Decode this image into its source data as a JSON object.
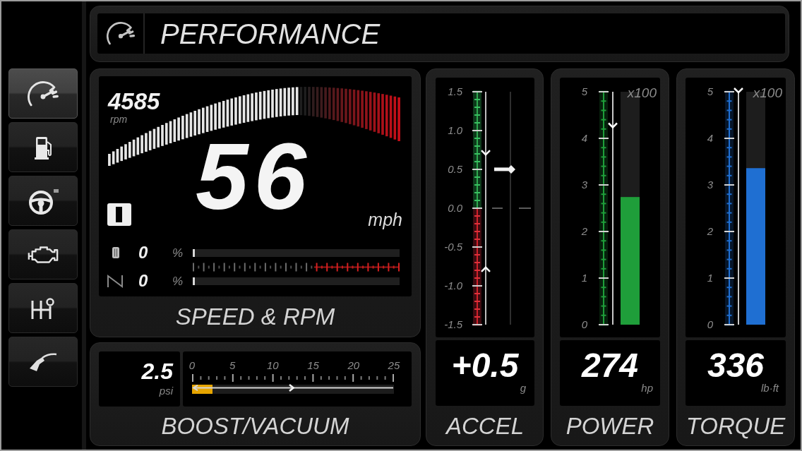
{
  "sidebar": {
    "items": [
      {
        "selected": true
      },
      {
        "selected": false
      },
      {
        "selected": false
      },
      {
        "selected": false
      },
      {
        "selected": false
      },
      {
        "selected": false
      }
    ]
  },
  "header": {
    "title": "PERFORMANCE"
  },
  "speed_rpm": {
    "tachometer": {
      "reading": "4585",
      "unit": "rpm",
      "level": 0.65
    },
    "speed": {
      "reading": "56",
      "unit": "mph"
    },
    "pedals": [
      {
        "reading": "0",
        "unit": "%",
        "level": 0
      },
      {
        "reading": "0",
        "unit": "%",
        "level": 0
      }
    ],
    "label": "SPEED & RPM"
  },
  "boost": {
    "reading": "2.5",
    "unit": "psi",
    "ticks": [
      "0",
      "5",
      "10",
      "15",
      "20",
      "25"
    ],
    "level": 0.1,
    "peak_marker": {
      "level": 0.5
    },
    "label": "BOOST/VACUUM"
  },
  "accel": {
    "ticks": [
      "1.5",
      "1.0",
      "0.5",
      "0.0",
      "-0.5",
      "-1.0",
      "-1.5"
    ],
    "pointer": {
      "level": 0.667
    },
    "peak_high": {
      "level": 0.733
    },
    "peak_low": {
      "level": 0.243
    },
    "reading": "+0.5",
    "unit": "g",
    "label": "ACCEL"
  },
  "bar_gauges": [
    {
      "label": "POWER",
      "reading": "274",
      "unit": "hp",
      "multiplier": "x100",
      "ticks": [
        "5",
        "4",
        "3",
        "2",
        "1",
        "0"
      ],
      "color": "#1f9e3a",
      "level": 0.548,
      "peak_marker": {
        "level": 0.85
      }
    },
    {
      "label": "TORQUE",
      "reading": "336",
      "unit": "lb·ft",
      "multiplier": "x100",
      "ticks": [
        "5",
        "4",
        "3",
        "2",
        "1",
        "0"
      ],
      "color": "#1f6fd2",
      "level": 0.672,
      "peak_marker": {
        "level": 1.0
      }
    }
  ]
}
